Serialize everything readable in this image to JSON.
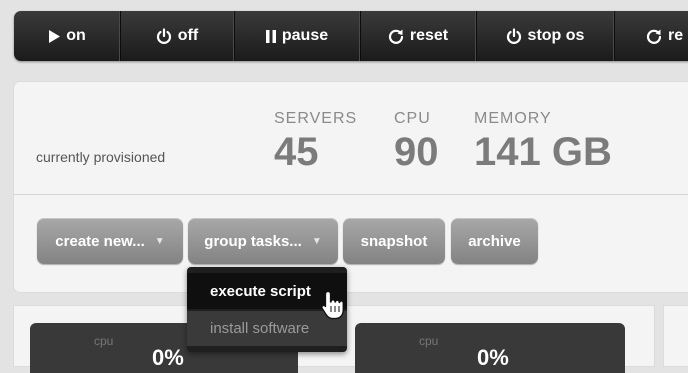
{
  "toolbar": {
    "buttons": [
      {
        "label": "on",
        "icon": "play-icon"
      },
      {
        "label": "off",
        "icon": "power-icon"
      },
      {
        "label": "pause",
        "icon": "pause-icon"
      },
      {
        "label": "reset",
        "icon": "refresh-icon"
      },
      {
        "label": "stop os",
        "icon": "power-icon"
      },
      {
        "label": "re",
        "icon": "refresh-icon"
      }
    ]
  },
  "summary": {
    "provisioned_label": "currently provisioned",
    "servers_header": "SERVERS",
    "servers_value": "45",
    "cpu_header": "CPU",
    "cpu_value": "90",
    "memory_header": "MEMORY",
    "memory_value": "141 GB"
  },
  "actions": {
    "create_new": "create new...",
    "group_tasks": "group tasks...",
    "snapshot": "snapshot",
    "archive": "archive"
  },
  "group_tasks_menu": {
    "items": [
      {
        "label": "execute script",
        "state": "hovered"
      },
      {
        "label": "install software",
        "state": "disabled"
      }
    ]
  },
  "server_cards": [
    {
      "metric_label": "cpu",
      "value": "0%"
    },
    {
      "metric_label": "cpu",
      "value": "0%"
    }
  ]
}
